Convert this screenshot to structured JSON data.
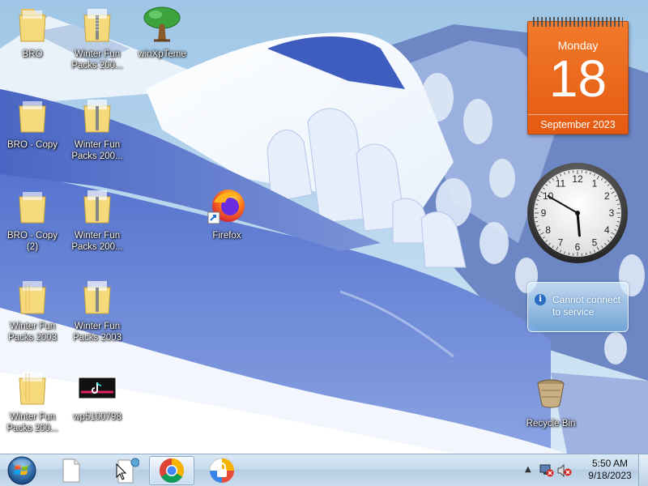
{
  "desktop": {
    "icons": [
      {
        "label": "BRO",
        "icon": "folder-icon"
      },
      {
        "label": "Winter Fun Packs 200...",
        "icon": "zip-folder-icon"
      },
      {
        "label": "winXpTeme",
        "icon": "tree-icon"
      },
      {
        "label": "BRO - Copy",
        "icon": "folder-icon"
      },
      {
        "label": "Winter Fun Packs 200...",
        "icon": "zip-folder-icon"
      },
      {
        "label": "BRO - Copy (2)",
        "icon": "folder-icon"
      },
      {
        "label": "Winter Fun Packs 200...",
        "icon": "zip-folder-icon"
      },
      {
        "label": "Firefox",
        "icon": "firefox-icon"
      },
      {
        "label": "Winter Fun Packs 2003",
        "icon": "folder-icon"
      },
      {
        "label": "Winter Fun Packs 2003",
        "icon": "zip-folder-icon"
      },
      {
        "label": "Winter Fun Packs 200...",
        "icon": "folder-icon"
      },
      {
        "label": "wp5100798",
        "icon": "tiktok-image-icon"
      },
      {
        "label": "Recycle Bin",
        "icon": "recycle-bin-icon"
      }
    ]
  },
  "gadgets": {
    "calendar": {
      "day": "Monday",
      "date": "18",
      "month_year": "September 2023"
    },
    "clock": {
      "hour": 5,
      "minute": 50
    },
    "notification": {
      "message": "Cannot connect to service"
    }
  },
  "taskbar": {
    "start_icon": "windows-start-orb-icon",
    "pinned": [
      "blank-document-icon",
      "notepad-document-icon",
      "chrome-icon",
      "lock-app-icon"
    ],
    "tray_icons": [
      "show-hidden-icons-arrow",
      "network-error-icon",
      "volume-muted-icon"
    ],
    "time": "5:50 AM",
    "date": "9/18/2023"
  },
  "colors": {
    "calendar_orange": "#ee6a1c",
    "taskbar_blue": "#c5d9ec",
    "icon_label": "#ffffff"
  }
}
